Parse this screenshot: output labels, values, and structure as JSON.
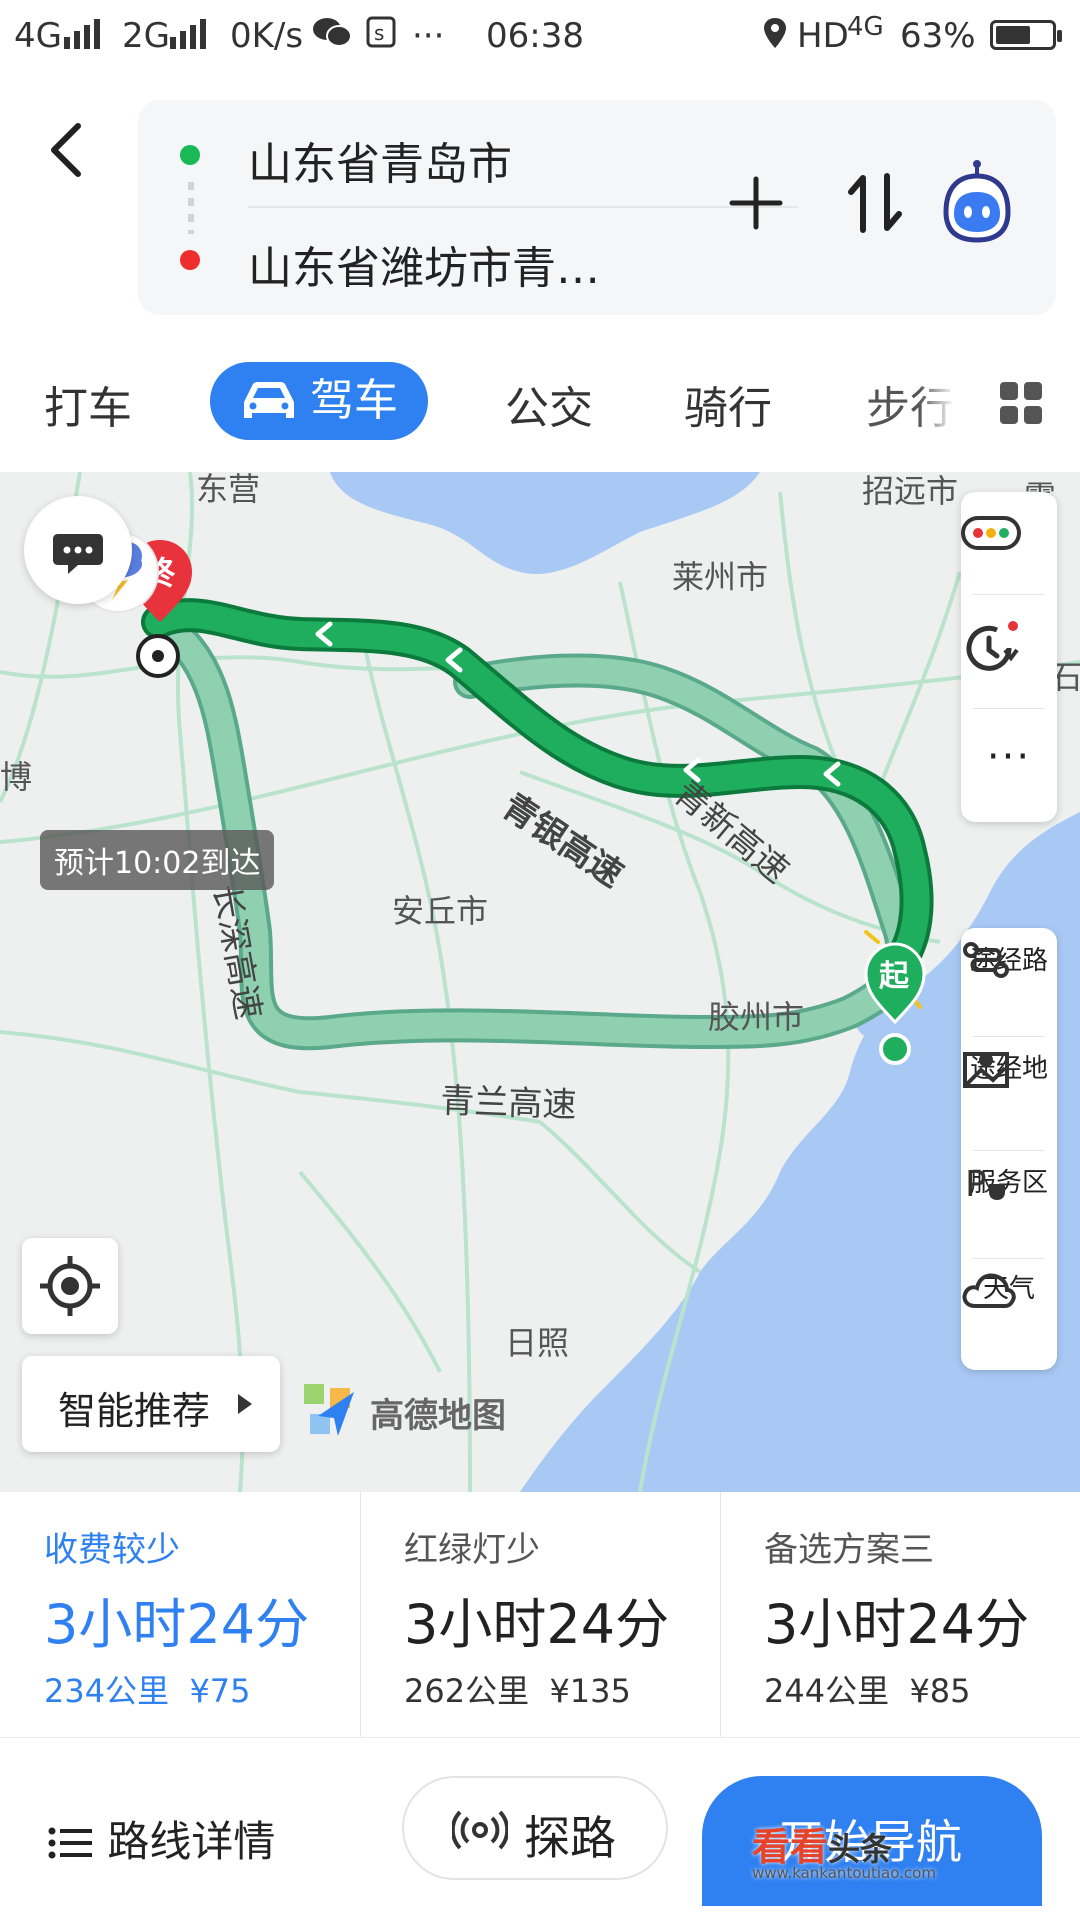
{
  "status_bar": {
    "network1": "4G",
    "network2": "2G",
    "speed": "0K/s",
    "time": "06:38",
    "hd": "HD",
    "net3": "4G",
    "battery": "63%",
    "battery_level": 0.63
  },
  "route": {
    "origin": "山东省青岛市",
    "destination": "山东省潍坊市青…"
  },
  "tabs": [
    "打车",
    "驾车",
    "公交",
    "骑行",
    "步行"
  ],
  "map": {
    "cities": [
      "东营",
      "招远市",
      "莱州市",
      "博",
      "安丘市",
      "胶州市",
      "日照",
      "霞",
      "石"
    ],
    "roads": [
      "青银高速",
      "青新高速",
      "长深高速",
      "青兰高速"
    ],
    "end_marker": "终",
    "start_marker": "起",
    "eta": "预计10:02到达",
    "smart_recommend": "智能推荐",
    "logo_text": "高德地图",
    "tools": [
      "途经路",
      "途经地",
      "服务区",
      "天气"
    ]
  },
  "plans": [
    {
      "title": "收费较少",
      "time": "3小时24分",
      "distance": "234公里",
      "cost": "¥75"
    },
    {
      "title": "红绿灯少",
      "time": "3小时24分",
      "distance": "262公里",
      "cost": "¥135"
    },
    {
      "title": "备选方案三",
      "time": "3小时24分",
      "distance": "244公里",
      "cost": "¥85"
    }
  ],
  "bottom": {
    "route_detail": "路线详情",
    "explore": "探路",
    "start_nav": "开始导航"
  },
  "watermark": {
    "brand": "看看",
    "brand2": "头条",
    "url": "www.kankantoutiao.com"
  },
  "colors": {
    "accent": "#2f80f0",
    "route_main": "#1a9d54",
    "route_alt": "#8ed0b0",
    "water": "#a9c9f5"
  }
}
